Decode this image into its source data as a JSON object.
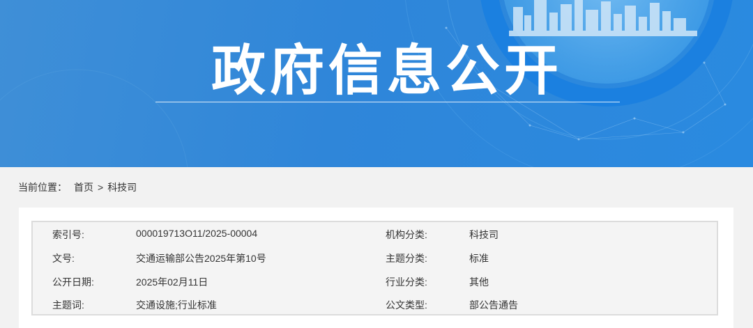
{
  "banner": {
    "title": "政府信息公开"
  },
  "breadcrumb": {
    "label": "当前位置：",
    "home": "首页",
    "separator": ">",
    "current": "科技司"
  },
  "info": {
    "rows": [
      {
        "label_left": "索引号:",
        "value_left": "000019713O11/2025-00004",
        "label_right": "机构分类:",
        "value_right": "科技司"
      },
      {
        "label_left": "文号:",
        "value_left": "交通运输部公告2025年第10号",
        "label_right": "主题分类:",
        "value_right": "标准"
      },
      {
        "label_left": "公开日期:",
        "value_left": "2025年02月11日",
        "label_right": "行业分类:",
        "value_right": "其他"
      },
      {
        "label_left": "主题词:",
        "value_left": "交通设施;行业标准",
        "label_right": "公文类型:",
        "value_right": "部公告通告"
      }
    ]
  },
  "colors": {
    "banner_blue": "#2f86d9",
    "page_bg": "#f2f2f2",
    "text": "#333333"
  }
}
